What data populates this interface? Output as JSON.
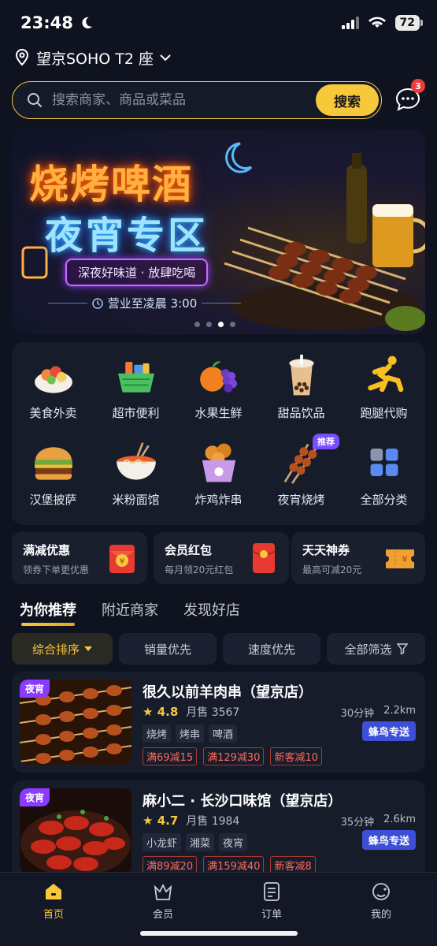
{
  "status_bar": {
    "time": "23:48",
    "battery": "72"
  },
  "location": {
    "address": "望京SOHO T2 座"
  },
  "search": {
    "placeholder": "搜索商家、商品或菜品",
    "button_label": "搜索",
    "message_badge": "3"
  },
  "banner": {
    "title_line1": "烧烤啤酒",
    "title_line2": "夜宵专区",
    "tagline": "深夜好味道 · 放肆吃喝",
    "hours": "营业至凌晨 3:00",
    "slide_count": 4,
    "active_slide": 3
  },
  "categories": [
    {
      "label": "美食外卖",
      "icon": "food-delivery-icon"
    },
    {
      "label": "超市便利",
      "icon": "supermarket-icon"
    },
    {
      "label": "水果生鲜",
      "icon": "fruit-icon"
    },
    {
      "label": "甜品饮品",
      "icon": "bubble-tea-icon"
    },
    {
      "label": "跑腿代购",
      "icon": "runner-icon"
    },
    {
      "label": "汉堡披萨",
      "icon": "burger-icon"
    },
    {
      "label": "米粉面馆",
      "icon": "noodle-icon"
    },
    {
      "label": "炸鸡炸串",
      "icon": "fried-chicken-icon"
    },
    {
      "label": "夜宵烧烤",
      "icon": "skewer-icon",
      "badge": "推荐"
    },
    {
      "label": "全部分类",
      "icon": "all-categories-icon"
    }
  ],
  "promos": [
    {
      "title": "满减优惠",
      "subtitle": "领券下单更优惠",
      "icon": "red-envelope-yen-icon"
    },
    {
      "title": "会员红包",
      "subtitle": "每月领20元红包",
      "icon": "red-envelope-icon"
    },
    {
      "title": "天天神券",
      "subtitle": "最高可减20元",
      "icon": "coupon-ticket-icon"
    }
  ],
  "feed_tabs": [
    "为你推荐",
    "附近商家",
    "发现好店"
  ],
  "sort_options": [
    "综合排序",
    "销量优先",
    "速度优先",
    "全部筛选"
  ],
  "shops": [
    {
      "tag": "夜宵",
      "name": "很久以前羊肉串（望京店）",
      "rating": "4.8",
      "monthly_sales": "月售 3567",
      "time": "30分钟",
      "distance": "2.2km",
      "chips": [
        "烧烤",
        "烤串",
        "啤酒"
      ],
      "delivery": "蜂鸟专送",
      "coupons": [
        "满69减15",
        "满129减30",
        "新客减10"
      ]
    },
    {
      "tag": "夜宵",
      "name": "麻小二 · 长沙口味馆（望京店）",
      "rating": "4.7",
      "monthly_sales": "月售 1984",
      "time": "35分钟",
      "distance": "2.6km",
      "chips": [
        "小龙虾",
        "湘菜",
        "夜宵"
      ],
      "delivery": "蜂鸟专送",
      "coupons": [
        "满89减20",
        "满159减40",
        "新客减8"
      ]
    }
  ],
  "bottom_nav": [
    {
      "label": "首页",
      "icon": "home-icon",
      "active": true
    },
    {
      "label": "会员",
      "icon": "crown-icon"
    },
    {
      "label": "订单",
      "icon": "order-list-icon"
    },
    {
      "label": "我的",
      "icon": "profile-icon"
    }
  ],
  "colors": {
    "accent": "#f7c83a",
    "background": "#0f1320",
    "card": "#171c2b",
    "delivery_badge": "#3d4fd6",
    "coupon_text": "#ff6a5a"
  }
}
